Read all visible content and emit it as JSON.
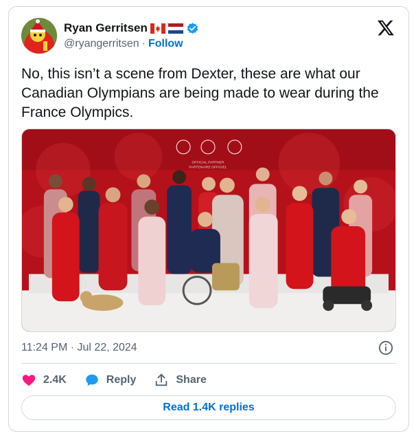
{
  "author": {
    "name": "Ryan Gerritsen",
    "handle": "@ryangerritsen",
    "separator": "·",
    "follow_label": "Follow",
    "flags": [
      "canada-flag-icon",
      "netherlands-flag-icon"
    ]
  },
  "tweet": {
    "text": "No, this isn’t a scene from Dexter, these are what our Canadian Olympians are being made to wear during the France Olympics.",
    "timestamp": "11:24 PM · Jul 22, 2024"
  },
  "media": {
    "banner_line1": "OFFICIAL PARTNER",
    "banner_line2": "PARTENAIRE OFFICIEL"
  },
  "actions": {
    "like_count": "2.4K",
    "reply_label": "Reply",
    "share_label": "Share",
    "read_replies_label": "Read 1.4K replies"
  },
  "colors": {
    "link": "#006fd6",
    "like": "#f91880",
    "secondary_text": "#536471",
    "border": "#cfd9de"
  }
}
